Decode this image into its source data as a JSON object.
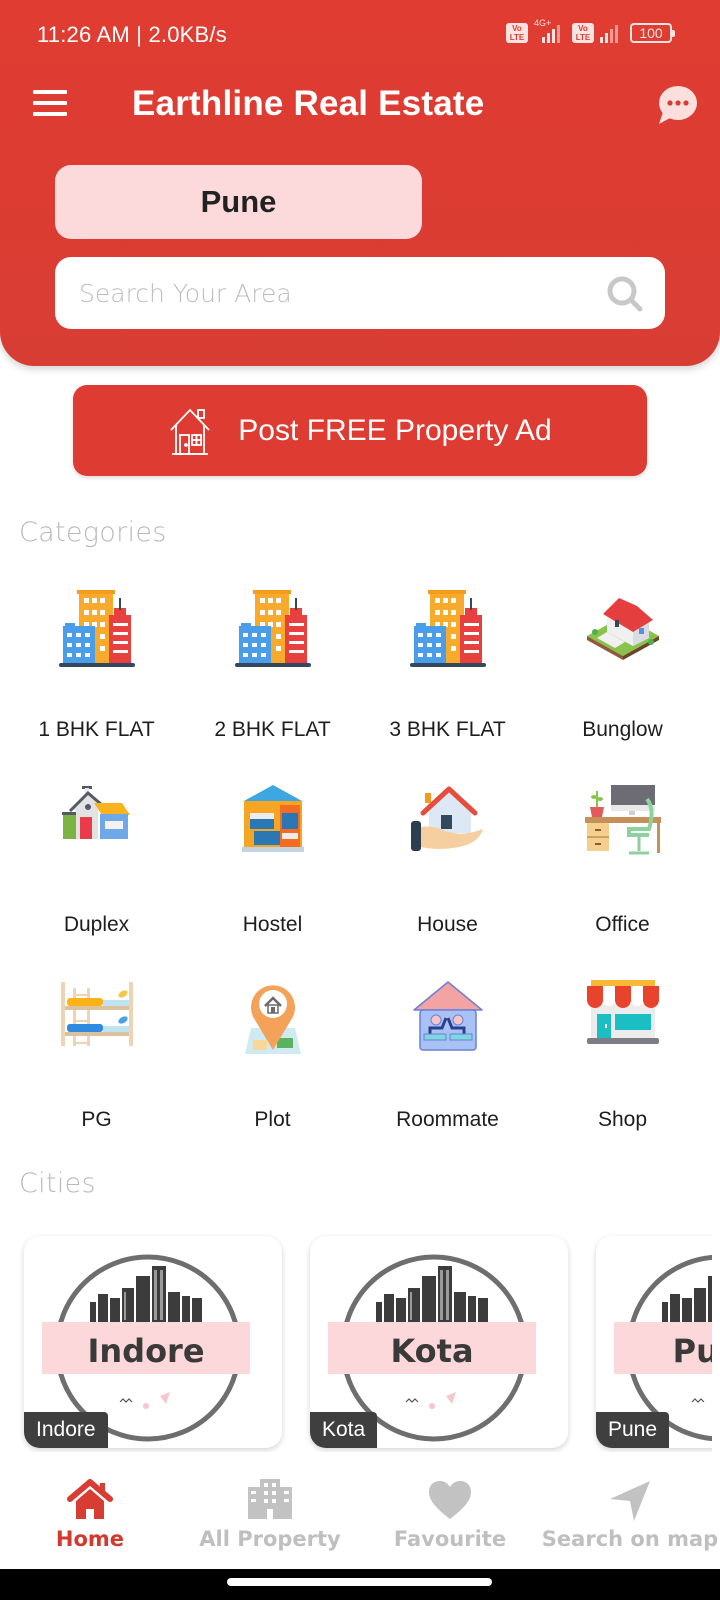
{
  "status_bar": {
    "time_speed": "11:26 AM | 2.0KB/s",
    "volte_label": "Vo\nLTE",
    "network": "4G+",
    "battery": "100"
  },
  "header": {
    "title": "Earthline Real Estate",
    "menu_icon": "hamburger-menu-icon",
    "chat_icon": "chat-bubble-icon",
    "selected_city": "Pune",
    "search_placeholder": "Search Your Area",
    "search_value": ""
  },
  "post_ad": {
    "label": "Post FREE Property Ad",
    "icon": "house-outline-icon"
  },
  "categories": {
    "title": "Categories",
    "items": [
      {
        "label": "1 BHK FLAT",
        "icon": "buildings-icon"
      },
      {
        "label": "2 BHK FLAT",
        "icon": "buildings-icon"
      },
      {
        "label": "3 BHK FLAT",
        "icon": "buildings-icon"
      },
      {
        "label": "Bunglow",
        "icon": "bungalow-icon"
      },
      {
        "label": "Duplex",
        "icon": "duplex-house-icon"
      },
      {
        "label": "Hostel",
        "icon": "hostel-icon"
      },
      {
        "label": "House",
        "icon": "house-in-hand-icon"
      },
      {
        "label": "Office",
        "icon": "office-desk-icon"
      },
      {
        "label": "PG",
        "icon": "bunk-bed-icon"
      },
      {
        "label": "Plot",
        "icon": "map-pin-plot-icon"
      },
      {
        "label": "Roommate",
        "icon": "roommate-house-icon"
      },
      {
        "label": "Shop",
        "icon": "shop-storefront-icon"
      }
    ]
  },
  "cities": {
    "title": "Cities",
    "items": [
      {
        "name": "Indore",
        "banner": "Indore"
      },
      {
        "name": "Kota",
        "banner": "Kota"
      },
      {
        "name": "Pune",
        "banner": "Pune"
      }
    ]
  },
  "bottom_nav": {
    "items": [
      {
        "label": "Home",
        "icon": "home-icon",
        "active": true
      },
      {
        "label": "All Property",
        "icon": "building-icon",
        "active": false
      },
      {
        "label": "Favourite",
        "icon": "heart-icon",
        "active": false
      },
      {
        "label": "Search on map",
        "icon": "navigation-arrow-icon",
        "active": false
      }
    ]
  },
  "colors": {
    "primary": "#de3c32",
    "city_chip_bg": "#fcdadc",
    "inactive_nav": "#bfbfbf",
    "section_title": "#b9b9b9"
  }
}
